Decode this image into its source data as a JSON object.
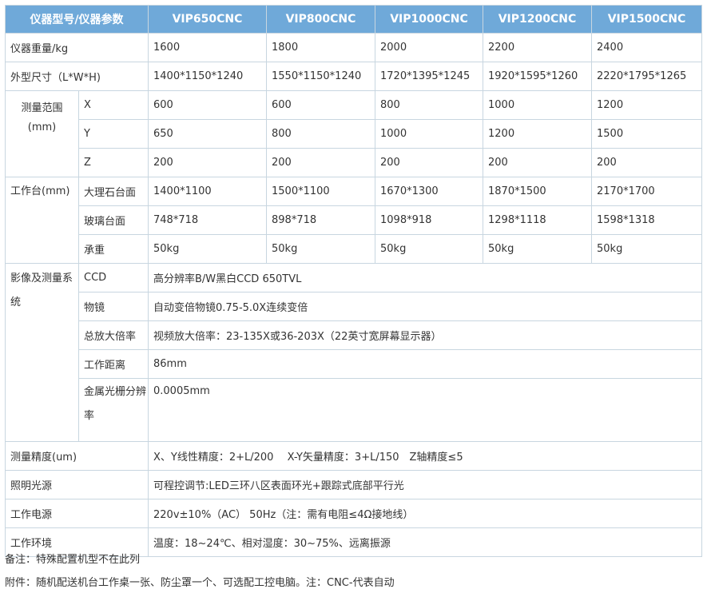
{
  "table": {
    "header": [
      "仪器型号/仪器参数",
      "VIP650CNC",
      "VIP800CNC",
      "VIP1000CNC",
      "VIP1200CNC",
      "VIP1500CNC"
    ],
    "weight": {
      "label": "仪器重量/kg",
      "values": [
        "1600",
        "1800",
        "2000",
        "2200",
        "2400"
      ]
    },
    "size": {
      "label": "外型尺寸（L*W*H)",
      "values": [
        "1400*1150*1240",
        "1550*1150*1240",
        "1720*1395*1245",
        "1920*1595*1260",
        "2220*1795*1265"
      ]
    },
    "range": {
      "label_line1": "测量范围",
      "label_line2": "(mm)",
      "rows": [
        {
          "axis": "X",
          "values": [
            "600",
            "600",
            "800",
            "1000",
            "1200"
          ]
        },
        {
          "axis": "Y",
          "values": [
            "650",
            "800",
            "1000",
            "1200",
            "1500"
          ]
        },
        {
          "axis": "Z",
          "values": [
            "200",
            "200",
            "200",
            "200",
            "200"
          ]
        }
      ]
    },
    "worktable": {
      "label": "工作台(mm)",
      "rows": [
        {
          "sub": "大理石台面",
          "values": [
            "1400*1100",
            "1500*1100",
            "1670*1300",
            "1870*1500",
            "2170*1700"
          ]
        },
        {
          "sub": "玻璃台面",
          "values": [
            "748*718",
            "898*718",
            "1098*918",
            "1298*1118",
            "1598*1318"
          ]
        },
        {
          "sub": "承重",
          "values": [
            "50kg",
            "50kg",
            "50kg",
            "50kg",
            "50kg"
          ]
        }
      ]
    },
    "imaging": {
      "label": "影像及测量系统",
      "rows": [
        {
          "sub": "CCD",
          "value": "高分辨率B/W黑白CCD 650TVL"
        },
        {
          "sub": "物镜",
          "value": "自动变倍物镜0.75-5.0X连续变倍"
        },
        {
          "sub": "总放大倍率",
          "value": "视频放大倍率：23-135X或36-203X（22英寸宽屏幕显示器）"
        },
        {
          "sub": "工作距离",
          "value": "86mm"
        },
        {
          "sub": "金属光栅分辨率",
          "value": "0.0005mm"
        }
      ]
    },
    "accuracy": {
      "label": "测量精度(um)",
      "value": "X、Y线性精度：2+L/200　 X-Y矢量精度：3+L/150　Z轴精度≤5"
    },
    "lighting": {
      "label": "照明光源",
      "value": "可程控调节:LED三环八区表面环光+跟踪式底部平行光"
    },
    "power": {
      "label": "工作电源",
      "value": "220v±10%（AC） 50Hz（注：需有电阻≤4Ω接地线）"
    },
    "environment": {
      "label": "工作环境",
      "value": "温度：18~24℃、相对湿度：30~75%、远离振源"
    }
  },
  "notes": {
    "remark": "备注：特殊配置机型不在此列",
    "attachment": "附件：随机配送机台工作桌一张、防尘罩一个、可选配工控电脑。注：CNC-代表自动"
  }
}
